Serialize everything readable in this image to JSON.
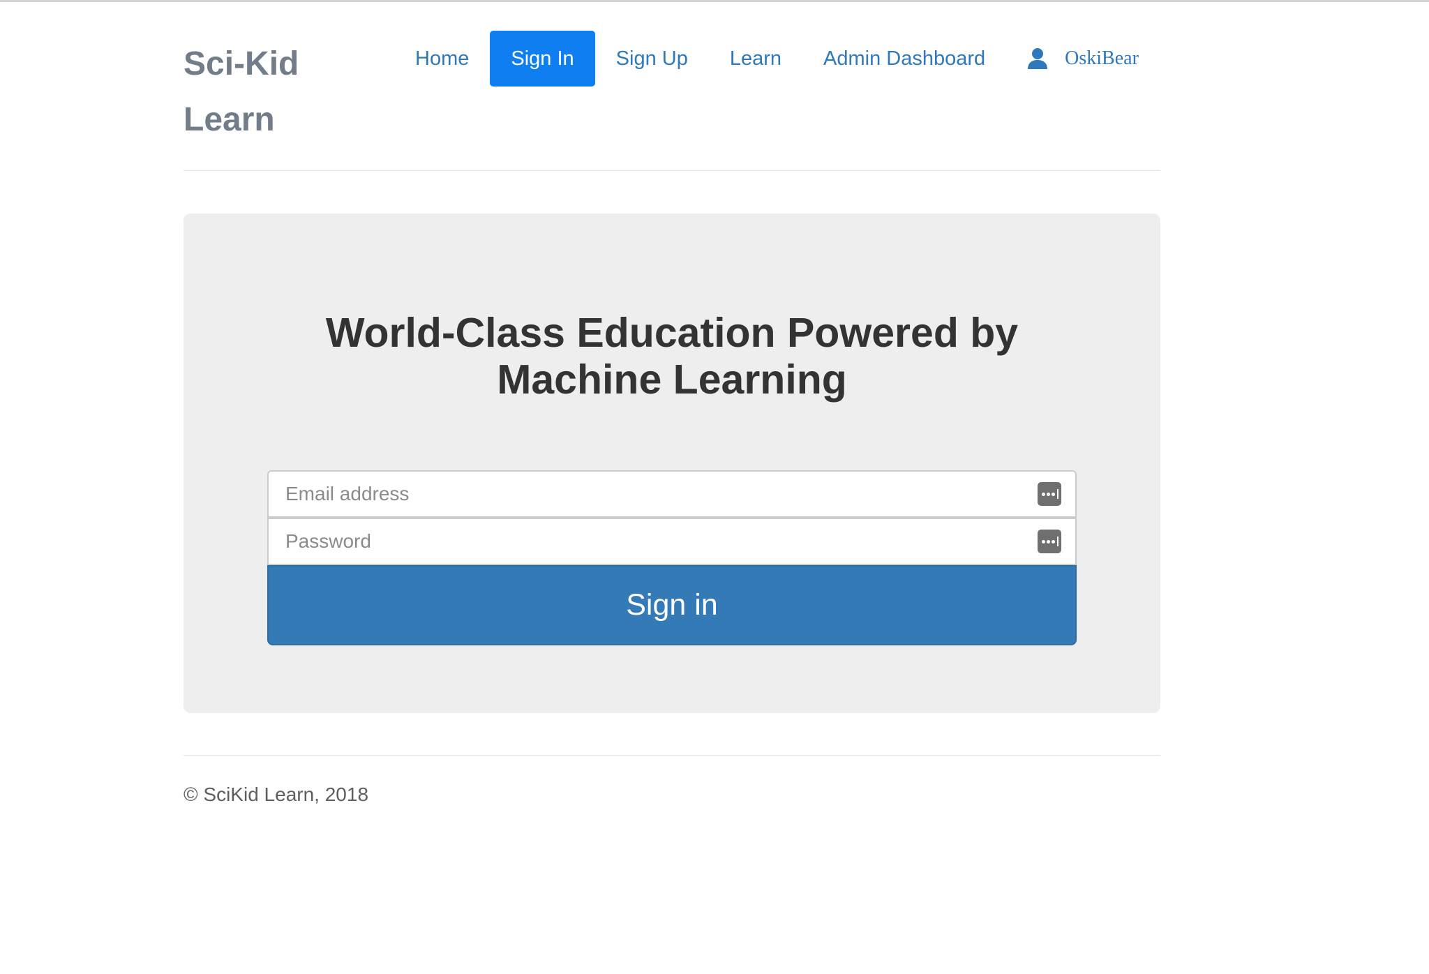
{
  "header": {
    "brand": "Sci-Kid Learn",
    "nav": [
      {
        "label": "Home",
        "active": false
      },
      {
        "label": "Sign In",
        "active": true
      },
      {
        "label": "Sign Up",
        "active": false
      },
      {
        "label": "Learn",
        "active": false
      },
      {
        "label": "Admin Dashboard",
        "active": false
      }
    ],
    "user": {
      "icon": "user-icon",
      "name": "OskiBear"
    }
  },
  "hero": {
    "headline": "World-Class Education Powered by Machine Learning"
  },
  "form": {
    "email_placeholder": "Email address",
    "password_placeholder": "Password",
    "field_icon": "password-manager-icon",
    "submit_label": "Sign in"
  },
  "footer": {
    "copyright": "© SciKid Learn, 2018"
  },
  "colors": {
    "accent": "#0e7ef0",
    "link": "#2e78bc",
    "button": "#337ab7",
    "panel": "#eeeeee"
  }
}
